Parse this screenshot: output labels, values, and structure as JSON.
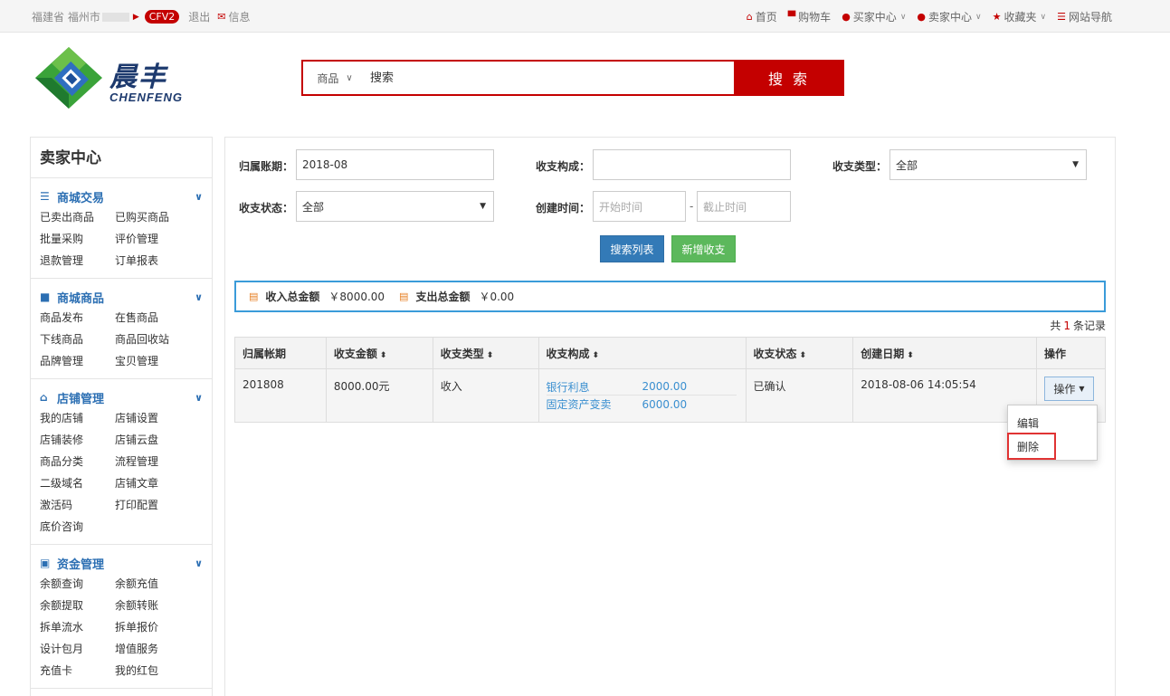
{
  "topbar": {
    "location": "福建省 福州市",
    "badge": "CFV2",
    "logout": "退出",
    "message": "信息",
    "nav": [
      {
        "label": "首页",
        "icon": "home-icon"
      },
      {
        "label": "购物车",
        "icon": "cart-icon"
      },
      {
        "label": "买家中心",
        "icon": "user-icon"
      },
      {
        "label": "卖家中心",
        "icon": "user-icon"
      },
      {
        "label": "收藏夹",
        "icon": "star-icon"
      },
      {
        "label": "网站导航",
        "icon": "list-icon"
      }
    ]
  },
  "logo": {
    "cn": "晨丰",
    "en": "CHENFENG"
  },
  "search": {
    "category": "商品",
    "placeholder": "搜索",
    "button": "搜 索"
  },
  "sidebar": {
    "title": "卖家中心",
    "groups": [
      {
        "title": "商城交易",
        "icon": "list-icon",
        "items": [
          "已卖出商品",
          "已购买商品",
          "批量采购",
          "评价管理",
          "退款管理",
          "订单报表"
        ]
      },
      {
        "title": "商城商品",
        "icon": "truck-icon",
        "items": [
          "商品发布",
          "在售商品",
          "下线商品",
          "商品回收站",
          "品牌管理",
          "宝贝管理"
        ]
      },
      {
        "title": "店铺管理",
        "icon": "home-icon",
        "items": [
          "我的店铺",
          "店铺设置",
          "店铺装修",
          "店铺云盘",
          "商品分类",
          "流程管理",
          "二级域名",
          "店铺文章",
          "激活码",
          "打印配置",
          "底价咨询"
        ]
      },
      {
        "title": "资金管理",
        "icon": "money-icon",
        "items": [
          "余额查询",
          "余额充值",
          "余额提取",
          "余额转账",
          "拆单流水",
          "拆单报价",
          "设计包月",
          "增值服务",
          "充值卡",
          "我的红包"
        ]
      }
    ]
  },
  "filters": {
    "period_label": "归属账期：",
    "period_value": "2018-08",
    "composition_label": "收支构成：",
    "composition_value": "",
    "type_label": "收支类型：",
    "type_value": "全部",
    "status_label": "收支状态：",
    "status_value": "全部",
    "created_label": "创建时间：",
    "start_placeholder": "开始时间",
    "end_placeholder": "截止时间",
    "separator": "-",
    "search_button": "搜索列表",
    "add_button": "新增收支"
  },
  "summary": {
    "income_label": "收入总金额",
    "income_value": "￥8000.00",
    "expense_label": "支出总金额",
    "expense_value": "￥0.00"
  },
  "records": {
    "prefix": "共",
    "count": "1",
    "suffix": "条记录"
  },
  "table": {
    "headers": [
      "归属帐期",
      "收支金额",
      "收支类型",
      "收支构成",
      "收支状态",
      "创建日期",
      "操作"
    ],
    "rows": [
      {
        "period": "201808",
        "amount": "8000.00元",
        "type": "收入",
        "composition": [
          {
            "name": "银行利息",
            "value": "2000.00"
          },
          {
            "name": "固定资产变卖",
            "value": "6000.00"
          }
        ],
        "status": "已确认",
        "created": "2018-08-06 14:05:54",
        "action": "操作"
      }
    ]
  },
  "dropdown": {
    "edit": "编辑",
    "delete": "删除"
  },
  "colors": {
    "brand": "#c40000",
    "link": "#2c6fb3",
    "primary": "#337ab7",
    "success": "#5cb85c",
    "highlight": "#e03333"
  }
}
